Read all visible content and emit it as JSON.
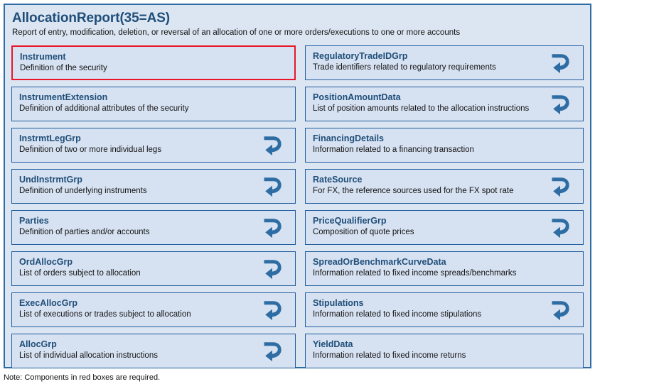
{
  "header": {
    "title": "AllocationReport(35=AS)",
    "subtitle": "Report of entry, modification, deletion, or reversal of an allocation of one or more orders/executions to one or more accounts"
  },
  "colors": {
    "panel_background": "#dce6f2",
    "panel_border": "#2e6ca4",
    "box_background": "#d6e1f1",
    "box_border": "#1f5c9e",
    "required_border": "#e8172a",
    "title_text": "#1f4e79",
    "body_text": "#141414",
    "icon_blue": "#2e6da4"
  },
  "columns": {
    "left": [
      {
        "name": "Instrument",
        "description": "Definition of the security",
        "required": true,
        "repeating": false
      },
      {
        "name": "InstrumentExtension",
        "description": "Definition of additional attributes of the security",
        "required": false,
        "repeating": false
      },
      {
        "name": "InstrmtLegGrp",
        "description": "Definition of two or more individual legs",
        "required": false,
        "repeating": true
      },
      {
        "name": "UndInstrmtGrp",
        "description": "Definition of underlying instruments",
        "required": false,
        "repeating": true
      },
      {
        "name": "Parties",
        "description": "Definition of parties and/or accounts",
        "required": false,
        "repeating": true
      },
      {
        "name": "OrdAllocGrp",
        "description": "List of orders subject to allocation",
        "required": false,
        "repeating": true
      },
      {
        "name": "ExecAllocGrp",
        "description": "List of executions or trades subject to allocation",
        "required": false,
        "repeating": true
      },
      {
        "name": "AllocGrp",
        "description": "List of individual allocation instructions",
        "required": false,
        "repeating": true
      }
    ],
    "right": [
      {
        "name": "RegulatoryTradeIDGrp",
        "description": "Trade identifiers related to regulatory requirements",
        "required": false,
        "repeating": true
      },
      {
        "name": "PositionAmountData",
        "description": "List of position amounts related to the allocation instructions",
        "required": false,
        "repeating": true
      },
      {
        "name": "FinancingDetails",
        "description": "Information related to a financing transaction",
        "required": false,
        "repeating": false
      },
      {
        "name": "RateSource",
        "description": "For FX, the reference sources used for the FX spot rate",
        "required": false,
        "repeating": true
      },
      {
        "name": "PriceQualifierGrp",
        "description": "Composition of quote prices",
        "required": false,
        "repeating": true
      },
      {
        "name": "SpreadOrBenchmarkCurveData",
        "description": "Information related to fixed income spreads/benchmarks",
        "required": false,
        "repeating": false
      },
      {
        "name": "Stipulations",
        "description": "Information related to fixed income stipulations",
        "required": false,
        "repeating": true
      },
      {
        "name": "YieldData",
        "description": "Information related to fixed income returns",
        "required": false,
        "repeating": false
      }
    ]
  },
  "note": "Note: Components in red boxes are required."
}
